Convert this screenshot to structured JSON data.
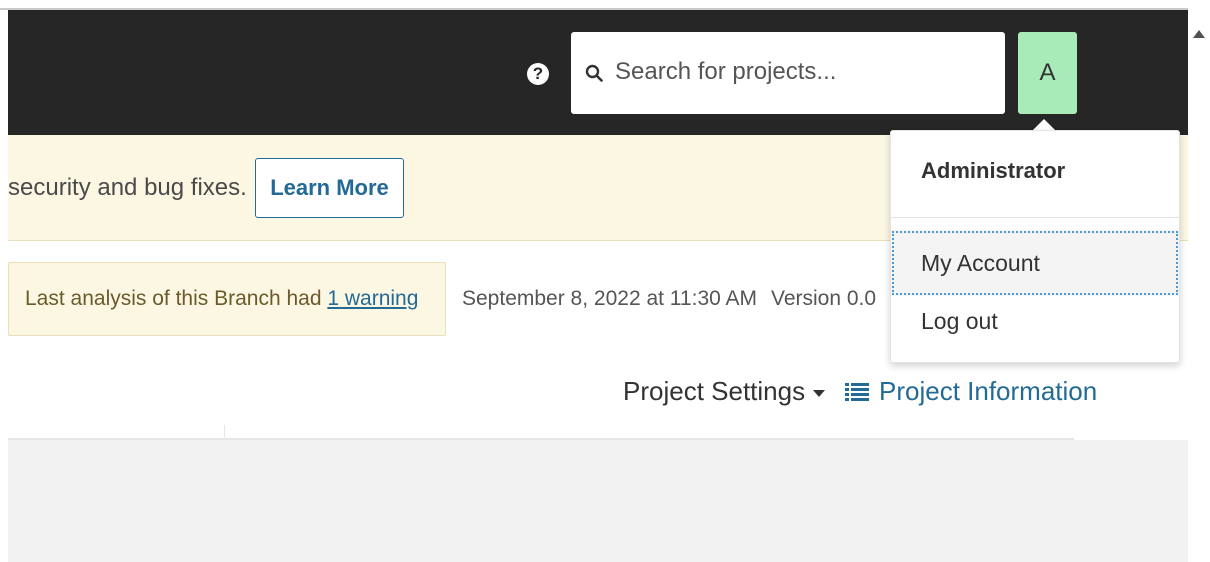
{
  "navbar": {
    "search": {
      "placeholder": "Search for projects..."
    },
    "avatar_letter": "A",
    "avatar_color": "#a8ebb8",
    "background": "#262626",
    "help_icon": "question-circle",
    "search_icon": "magnifier"
  },
  "notice": {
    "text": "security and bug fixes.",
    "button_label": "Learn More"
  },
  "analysis": {
    "prefix": "Last analysis of this Branch had ",
    "warning_link": "1 warning",
    "date": "September 8, 2022 at 11:30 AM",
    "version": "Version 0.0"
  },
  "project_nav": {
    "settings_label": "Project Settings",
    "info_label": "Project Information",
    "info_icon": "list"
  },
  "account_menu": {
    "header": "Administrator",
    "items": [
      {
        "label": "My Account",
        "focused": true
      },
      {
        "label": "Log out",
        "focused": false
      }
    ]
  },
  "colors": {
    "link": "#236a97",
    "banner": "#fcf7e3",
    "focus": "#4a9bd6"
  }
}
